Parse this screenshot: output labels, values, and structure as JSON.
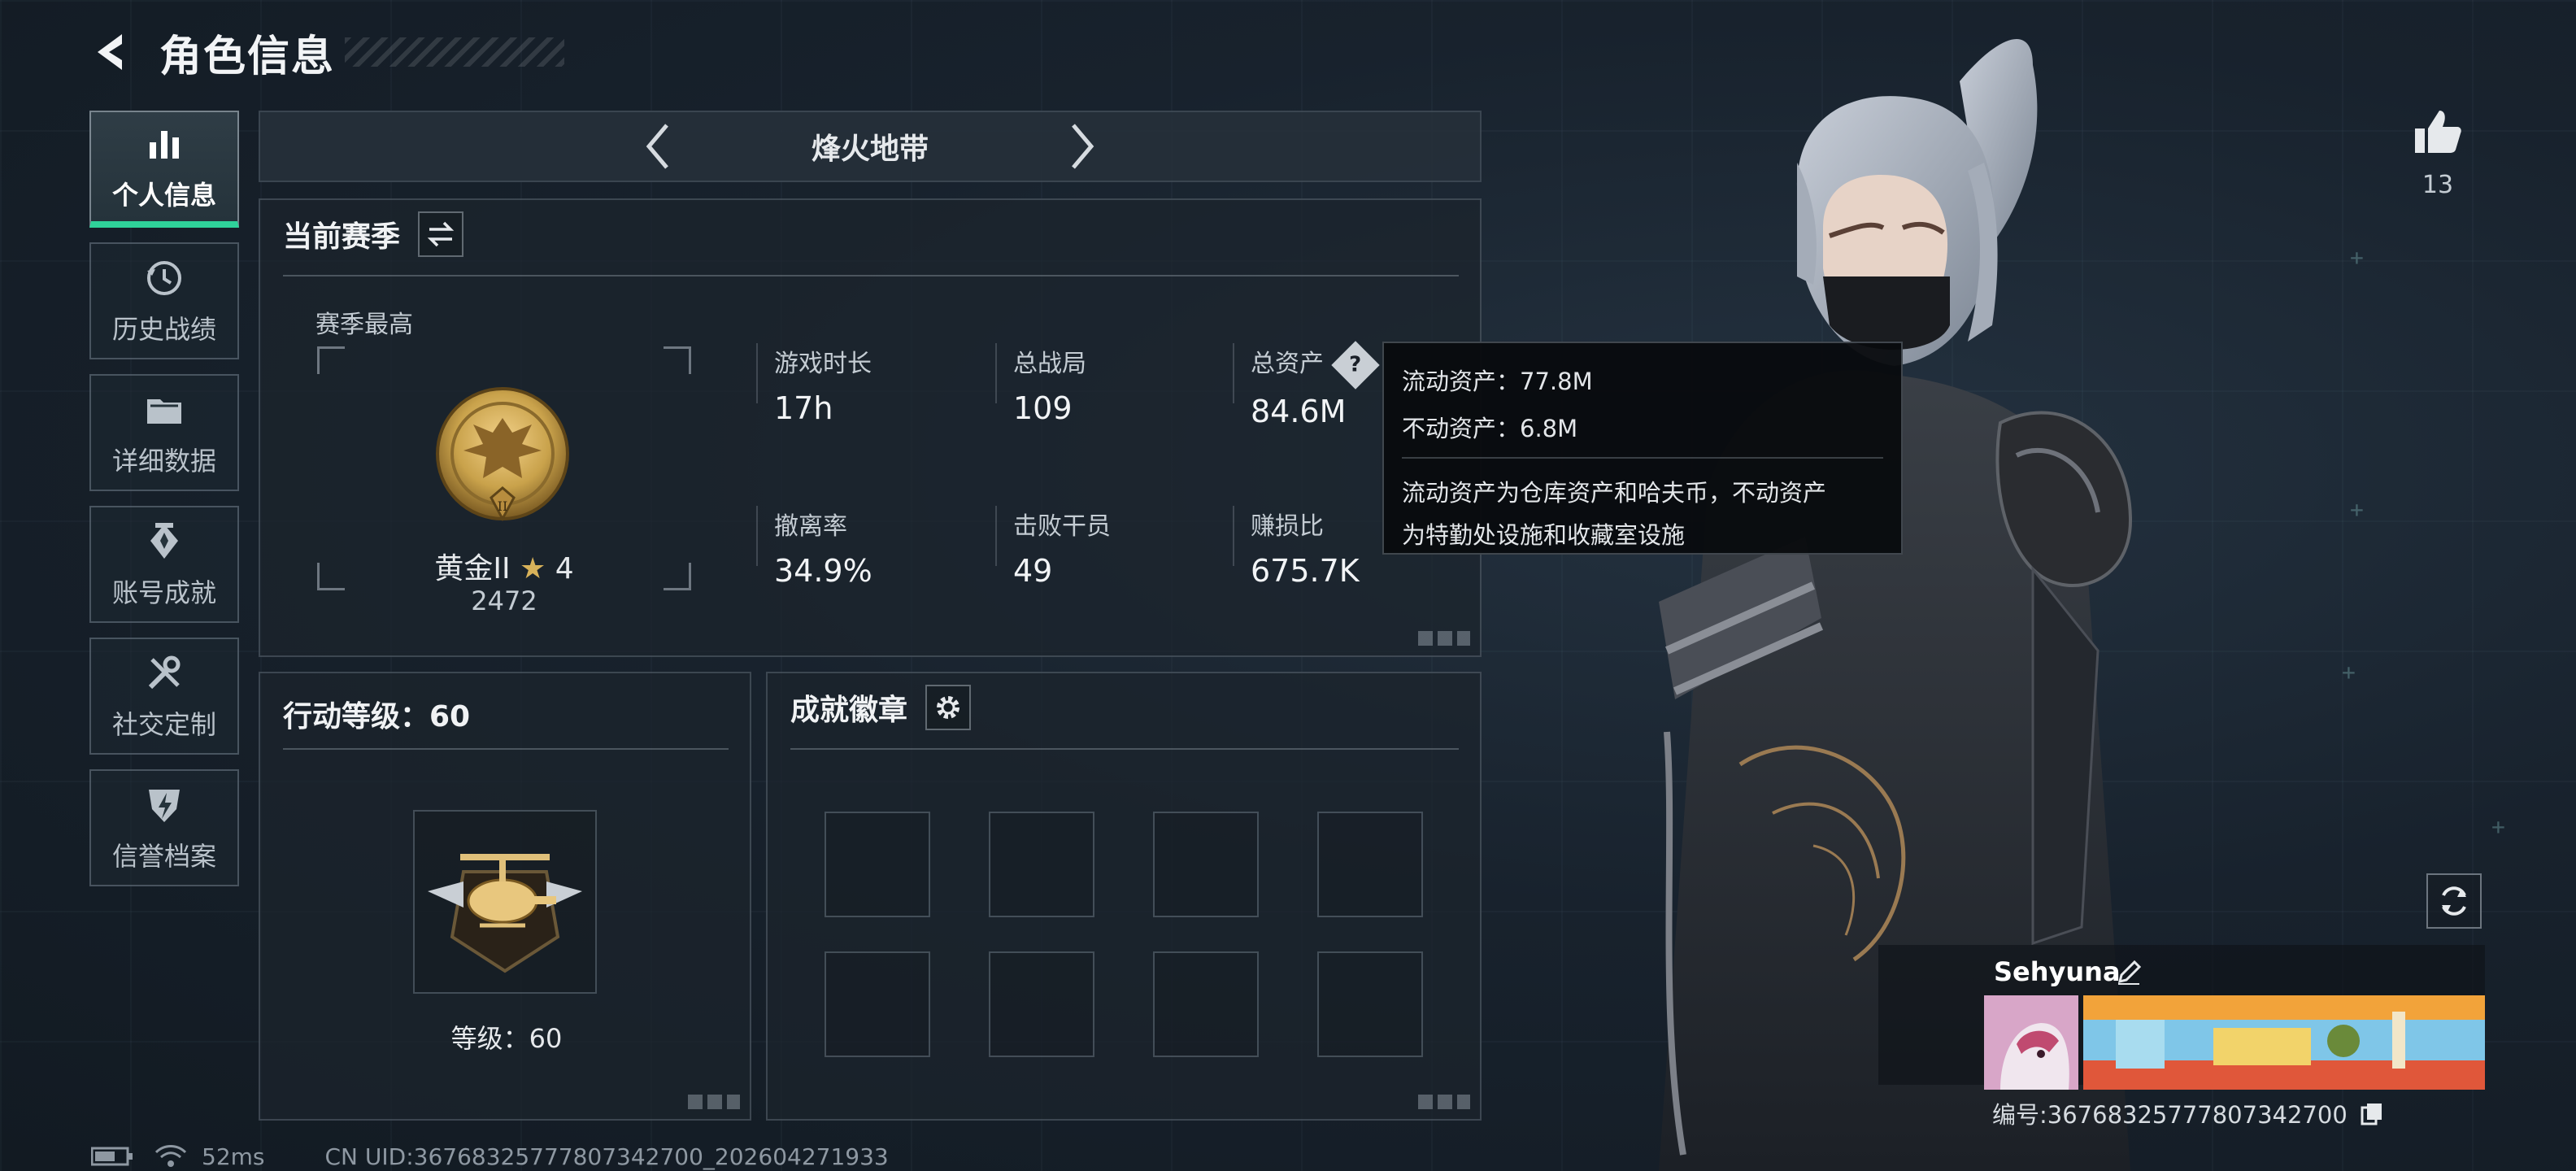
{
  "header": {
    "title": "角色信息"
  },
  "nav": {
    "items": [
      {
        "label": "个人信息",
        "icon": "bar-chart-icon",
        "active": true
      },
      {
        "label": "历史战绩",
        "icon": "history-icon",
        "active": false
      },
      {
        "label": "详细数据",
        "icon": "folder-icon",
        "active": false
      },
      {
        "label": "账号成就",
        "icon": "achievement-icon",
        "active": false
      },
      {
        "label": "社交定制",
        "icon": "tools-icon",
        "active": false
      },
      {
        "label": "信誉档案",
        "icon": "shield-bolt-icon",
        "active": false
      }
    ]
  },
  "mode": {
    "title": "烽火地带"
  },
  "season": {
    "title": "当前赛季",
    "best_label": "赛季最高",
    "rank_name": "黄金II",
    "rank_stars": "4",
    "rank_score": "2472",
    "stats": [
      {
        "label": "游戏时长",
        "value": "17h"
      },
      {
        "label": "总战局",
        "value": "109"
      },
      {
        "label": "总资产",
        "value": "84.6M"
      },
      {
        "label": "撤离率",
        "value": "34.9%"
      },
      {
        "label": "击败干员",
        "value": "49"
      },
      {
        "label": "赚损比",
        "value": "675.7K"
      }
    ],
    "help_glyph": "?"
  },
  "tooltip": {
    "liquid": "流动资产：77.8M",
    "fixed": "不动资产：6.8M",
    "note_line1": "流动资产为仓库资产和哈夫币，不动资产",
    "note_line2": "为特勤处设施和收藏室设施"
  },
  "action_level": {
    "title": "行动等级：60",
    "level_text": "等级：60"
  },
  "badges": {
    "title": "成就徽章",
    "slot_count": 8
  },
  "profile": {
    "likes": "13",
    "name": "Sehyuna",
    "id_text": "编号:3676832577780734270​0",
    "banner_colors": [
      "#f2a33a",
      "#7fc6e8",
      "#e0573a"
    ]
  },
  "status": {
    "ping": "52ms",
    "uid_text": "CN UID:3676832577780734270​0_202604271933"
  },
  "colors": {
    "accent": "#2fd29a",
    "panel_border": "#8a98a6",
    "gold": "#c9a24b"
  }
}
